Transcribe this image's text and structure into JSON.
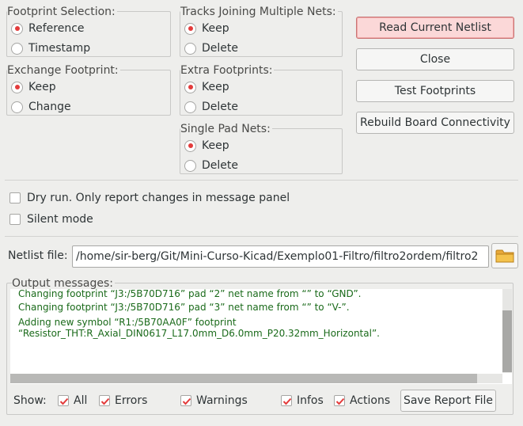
{
  "footprint_selection": {
    "title": "Footprint Selection:",
    "options": [
      {
        "label": "Reference",
        "selected": true
      },
      {
        "label": "Timestamp",
        "selected": false
      }
    ]
  },
  "tracks_joining": {
    "title": "Tracks Joining Multiple Nets:",
    "options": [
      {
        "label": "Keep",
        "selected": true
      },
      {
        "label": "Delete",
        "selected": false
      }
    ]
  },
  "exchange_footprint": {
    "title": "Exchange Footprint:",
    "options": [
      {
        "label": "Keep",
        "selected": true
      },
      {
        "label": "Change",
        "selected": false
      }
    ]
  },
  "extra_footprints": {
    "title": "Extra Footprints:",
    "options": [
      {
        "label": "Keep",
        "selected": true
      },
      {
        "label": "Delete",
        "selected": false
      }
    ]
  },
  "single_pad_nets": {
    "title": "Single Pad Nets:",
    "options": [
      {
        "label": "Keep",
        "selected": true
      },
      {
        "label": "Delete",
        "selected": false
      }
    ]
  },
  "buttons": {
    "read_netlist": "Read Current Netlist",
    "close": "Close",
    "test_footprints": "Test Footprints",
    "rebuild": "Rebuild Board Connectivity"
  },
  "options": {
    "dry_run": {
      "label": "Dry run. Only report changes in message panel",
      "checked": false
    },
    "silent_mode": {
      "label": "Silent mode",
      "checked": false
    }
  },
  "netlist": {
    "label": "Netlist file:",
    "value": "/home/sir-berg/Git/Mini-Curso-Kicad/Exemplo01-Filtro/filtro2ordem/filtro2",
    "browse_icon": "folder-icon"
  },
  "output": {
    "title": "Output messages:",
    "messages": [
      "Changing footprint “J3:/5B70D716” pad “2” net name from “” to “GND”.",
      "Changing footprint “J3:/5B70D716” pad “3” net name from “” to “V-”.",
      "Adding new symbol “R1:/5B70AA0F” footprint",
      "“Resistor_THT:R_Axial_DIN0617_L17.0mm_D6.0mm_P20.32mm_Horizontal”."
    ],
    "message_color": "#1a6a1a"
  },
  "filters": {
    "show_label": "Show:",
    "items": [
      {
        "label": "All",
        "checked": true
      },
      {
        "label": "Errors",
        "checked": true
      },
      {
        "label": "Warnings",
        "checked": true
      },
      {
        "label": "Infos",
        "checked": true
      },
      {
        "label": "Actions",
        "checked": true
      }
    ],
    "save_report": "Save Report File"
  },
  "colors": {
    "background": "#eeeeec",
    "accent_red": "#e33b3b",
    "primary_button_bg": "#fbd8d8"
  }
}
